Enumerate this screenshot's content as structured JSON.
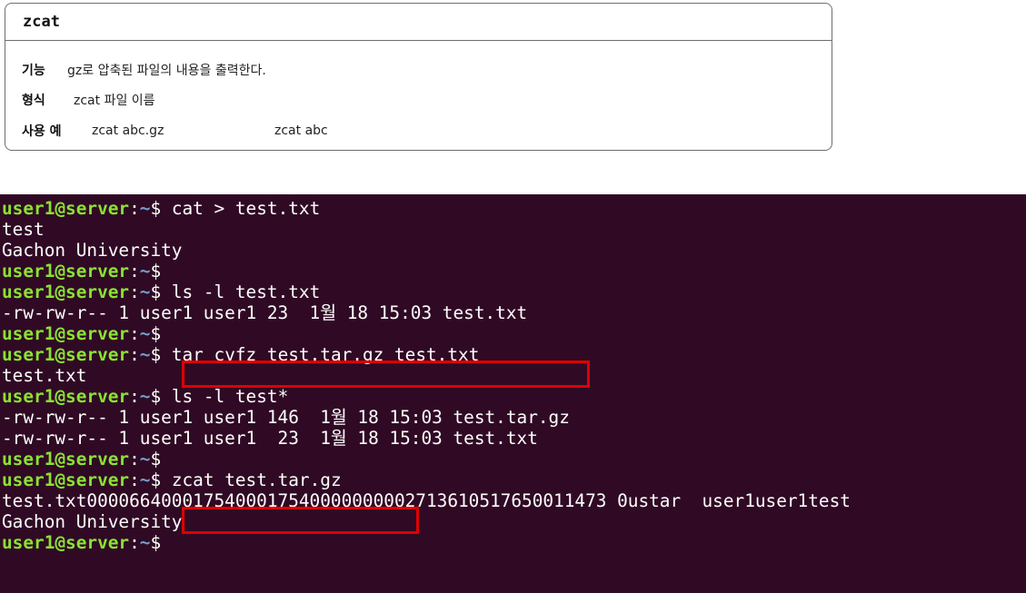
{
  "command_box": {
    "title": "zcat",
    "rows": [
      {
        "label": "기능",
        "value": "gz로 압축된 파일의 내용을 출력한다."
      },
      {
        "label": "형식",
        "value": "zcat 파일 이름"
      },
      {
        "label": "사용 예",
        "value": "zcat abc.gz",
        "value2": "zcat abc"
      }
    ]
  },
  "terminal": {
    "colors": {
      "background": "#300a24",
      "user": "#8ae234",
      "path": "#729fcf",
      "highlight": "#e00000"
    },
    "prompt": {
      "user": "user1@server",
      "colon": ":",
      "path": "~",
      "sign": "$"
    },
    "lines": [
      {
        "prompt": true,
        "text": " cat > test.txt"
      },
      {
        "prompt": false,
        "text": "test"
      },
      {
        "prompt": false,
        "text": "Gachon University"
      },
      {
        "prompt": true,
        "text": ""
      },
      {
        "prompt": true,
        "text": " ls -l test.txt"
      },
      {
        "prompt": false,
        "text": "-rw-rw-r-- 1 user1 user1 23  1월 18 15:03 test.txt"
      },
      {
        "prompt": true,
        "text": ""
      },
      {
        "prompt": true,
        "text": " tar cvfz test.tar.gz test.txt"
      },
      {
        "prompt": false,
        "text": "test.txt"
      },
      {
        "prompt": true,
        "text": " ls -l test*"
      },
      {
        "prompt": false,
        "text": "-rw-rw-r-- 1 user1 user1 146  1월 18 15:03 test.tar.gz"
      },
      {
        "prompt": false,
        "text": "-rw-rw-r-- 1 user1 user1  23  1월 18 15:03 test.txt"
      },
      {
        "prompt": true,
        "text": ""
      },
      {
        "prompt": true,
        "text": " zcat test.tar.gz"
      },
      {
        "prompt": false,
        "text": "test.txt0000664000175400017540000000002713610517650011473 0ustar  user1user1test"
      },
      {
        "prompt": false,
        "text": "Gachon University"
      },
      {
        "prompt": true,
        "text": ""
      }
    ]
  }
}
